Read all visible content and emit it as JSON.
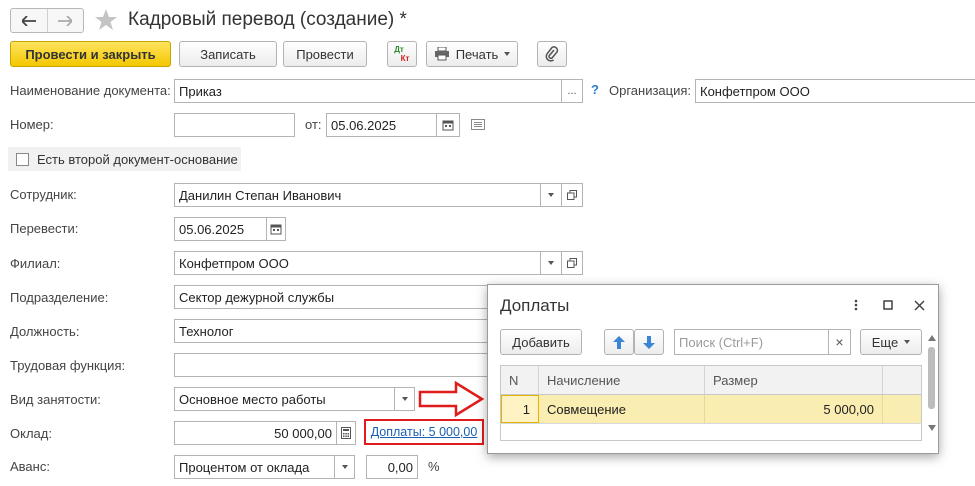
{
  "window": {
    "title": "Кадровый перевод (создание) *"
  },
  "toolbar": {
    "post_close": "Провести и закрыть",
    "save": "Записать",
    "post": "Провести",
    "dtkt_top": "Дт",
    "dtkt_bottom": "Кт",
    "print": "Печать"
  },
  "form": {
    "doc_name_label": "Наименование документа:",
    "doc_name_value": "Приказ",
    "doc_name_more": "...",
    "help": "?",
    "org_label": "Организация:",
    "org_value": "Конфетпром ООО",
    "number_label": "Номер:",
    "number_value": "",
    "date_from_label": "от:",
    "date_from_value": "05.06.2025",
    "second_doc_label": "Есть второй документ-основание",
    "employee_label": "Сотрудник:",
    "employee_value": "Данилин Степан Иванович",
    "transfer_label": "Перевести:",
    "transfer_value": "05.06.2025",
    "branch_label": "Филиал:",
    "branch_value": "Конфетпром ООО",
    "department_label": "Подразделение:",
    "department_value": "Сектор дежурной службы",
    "position_label": "Должность:",
    "position_value": "Технолог",
    "labor_function_label": "Трудовая функция:",
    "labor_function_value": "",
    "employment_label": "Вид занятости:",
    "employment_value": "Основное место работы",
    "salary_label": "Оклад:",
    "salary_value": "50 000,00",
    "allowances_link": "Доплаты: 5 000,00",
    "advance_label": "Аванс:",
    "advance_value": "Процентом от оклада",
    "advance_percent": "0,00",
    "percent_sign": "%"
  },
  "dialog": {
    "title": "Доплаты",
    "add": "Добавить",
    "search_placeholder": "Поиск (Ctrl+F)",
    "clear": "×",
    "more": "Еще",
    "columns": [
      "N",
      "Начисление",
      "Размер"
    ],
    "rows": [
      {
        "n": "1",
        "accrual": "Совмещение",
        "amount": "5 000,00"
      }
    ]
  },
  "colors": {
    "accent_yellow": "#f3c700",
    "link_blue": "#1a5fb4",
    "highlight_red": "#e01b1b",
    "row_selected": "#faedb2",
    "help_blue": "#2a7fd4"
  }
}
